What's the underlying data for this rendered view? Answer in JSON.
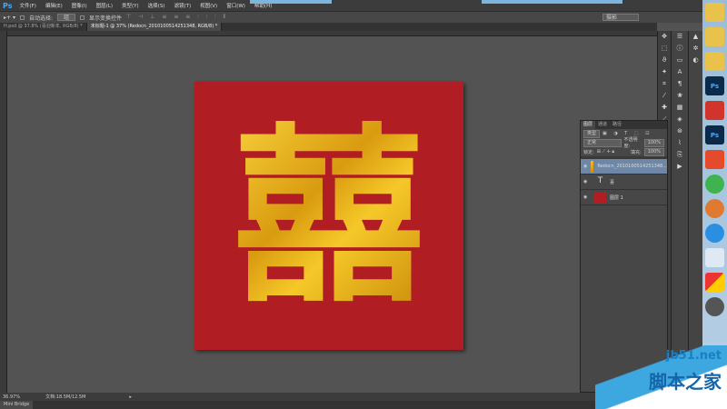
{
  "app": {
    "logo": "Ps"
  },
  "menu": [
    "文件(F)",
    "编辑(E)",
    "图像(I)",
    "图层(L)",
    "类型(Y)",
    "选择(S)",
    "滤镜(T)",
    "视图(V)",
    "窗口(W)",
    "帮助(H)"
  ],
  "options": {
    "auto_select_label": "自动选择:",
    "auto_select_value": "组",
    "show_transform_label": "显示变换控件",
    "workspace": "摄影"
  },
  "tabs": [
    {
      "label": "H.psd @ 37.8% (喜迎新年, RGB/8) *"
    },
    {
      "label": "未标题-1 @ 37% (Redocn_2010100514251348, RGB/8) *"
    }
  ],
  "canvas": {
    "glyph": "囍",
    "bg": "#b01e23",
    "gold": "#e8b520"
  },
  "layers_panel": {
    "tabs": [
      "图层",
      "通道",
      "路径"
    ],
    "filter": "类型",
    "blend_mode": "正常",
    "opacity_label": "不透明度:",
    "opacity": "100%",
    "lock_label": "锁定:",
    "fill_label": "填充:",
    "fill": "100%",
    "layers": [
      {
        "name": "Redocn_2010100514251348...",
        "type": "image"
      },
      {
        "name": "喜",
        "type": "text"
      },
      {
        "name": "图层 1",
        "type": "fill"
      }
    ]
  },
  "status": {
    "zoom": "36.97%",
    "doc": "文档:18.5M/12.5M"
  },
  "mini_bridge": "Mini Bridge",
  "watermark": {
    "url": "jb51.net",
    "name": "脚本之家"
  }
}
